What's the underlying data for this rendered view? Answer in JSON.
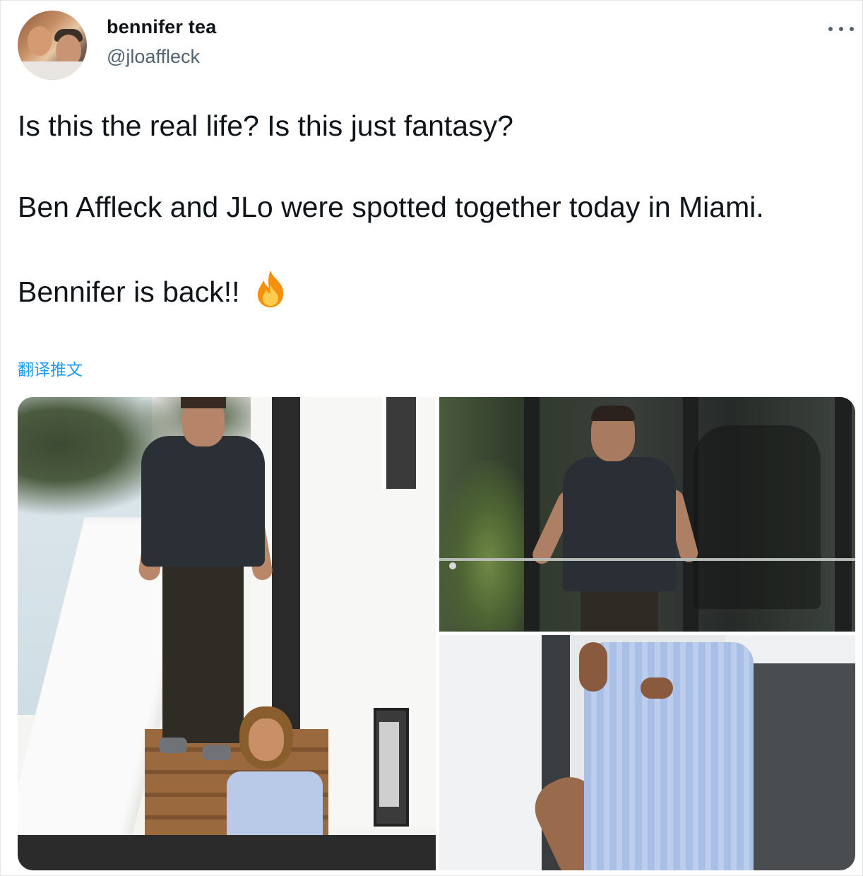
{
  "user": {
    "display_name": "bennifer tea",
    "handle": "@jloaffleck"
  },
  "tweet": {
    "line_1": "Is this the real life? Is this just fantasy?",
    "line_2": "Ben Affleck and JLo were spotted together today in Miami.",
    "line_3": "Bennifer is back!!",
    "emoji": "fire-icon",
    "translate_label": "翻译推文"
  },
  "media": {
    "photo_count": 3
  },
  "colors": {
    "text": "#0f1419",
    "secondary": "#536471",
    "link": "#1d9bf0"
  }
}
